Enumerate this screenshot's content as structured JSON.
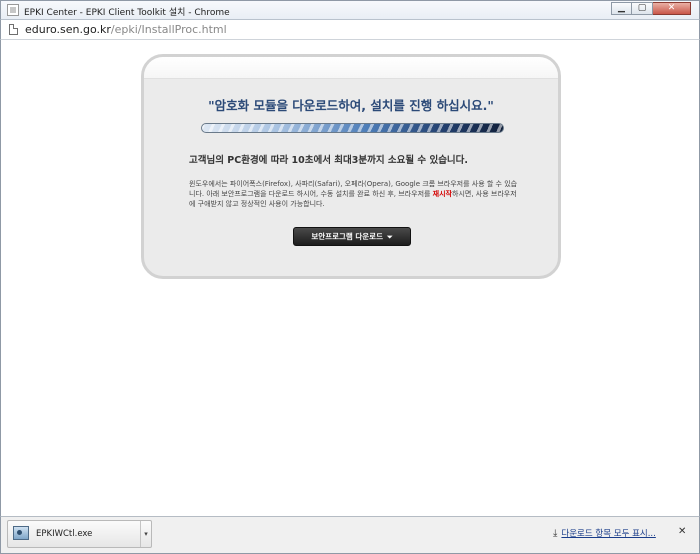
{
  "window": {
    "title": "EPKI Center - EPKI Client Toolkit 설치 - Chrome",
    "minimize": "▁",
    "maximize": "▢",
    "close": "✕"
  },
  "address": {
    "host": "eduro.sen.go.kr",
    "path": "/epki/InstallProc.html"
  },
  "panel": {
    "headline": "\"암호화 모듈을 다운로드하여, 설치를 진행 하십시요.\"",
    "progress": 1.0,
    "lead": "고객님의 PC환경에 따라 10초에서 최대3분까지 소요될 수 있습니다.",
    "desc_before": "윈도우에서는 파이어폭스(Firefox), 사파리(Safari), 오페라(Opera), Google 크롬 브라우저를 사용 할 수 있습니다. 아래 보안프로그램을 다운로드 하시어, 수동 설치를 완료 하신 후, 브라우저를 ",
    "desc_highlight": "재시작",
    "desc_after": "하시면, 사용 브라우저에 구애받지 않고 정상적인 사용이 가능합니다.",
    "download_button": "보안프로그램 다운로드",
    "download_arrow": "⏷"
  },
  "shelf": {
    "file_name": "EPKIWCtl.exe",
    "caret": "▾",
    "show_all": "다운로드 항목 모두 표시...",
    "show_all_icon": "⤓",
    "close": "✕"
  },
  "colors": {
    "headline": "#2c4a78",
    "highlight": "#d40000",
    "button": "#1c1c1c"
  }
}
